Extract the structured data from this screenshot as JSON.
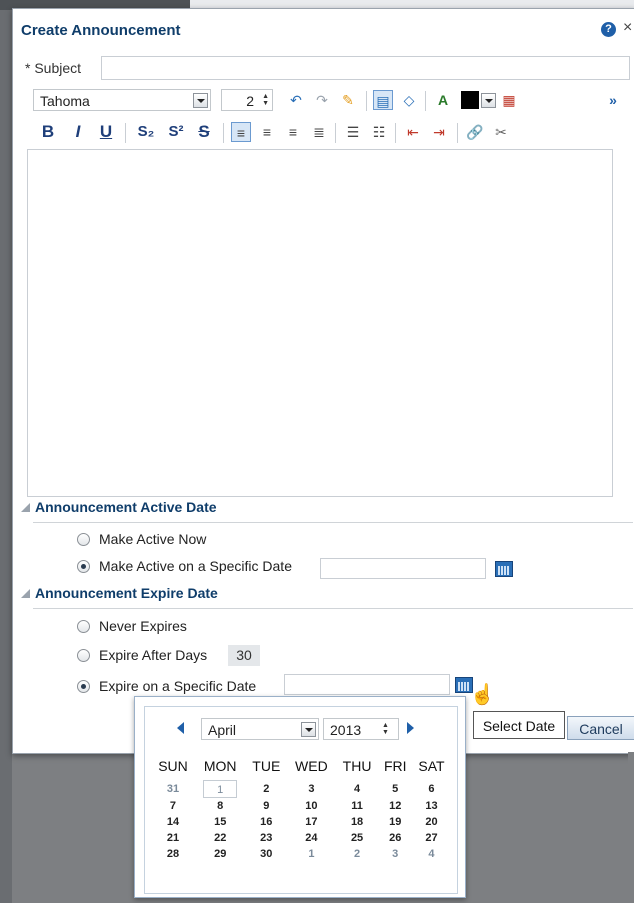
{
  "dialog": {
    "title": "Create Announcement",
    "help_icon": "?",
    "close_icon": "×"
  },
  "subject": {
    "label": "* Subject",
    "value": ""
  },
  "toolbar": {
    "font_family": "Tahoma",
    "font_size": "2",
    "overflow_glyph": "»",
    "icons_row1": [
      "undo-icon",
      "redo-icon",
      "clear-formatting-icon",
      "rich-text-mode-icon",
      "source-code-mode-icon",
      "font-color-icon",
      "color-swatch",
      "color-dropdown",
      "background-color-icon",
      "more-icon"
    ],
    "bold": "B",
    "italic": "I",
    "underline": "U",
    "subscript": "S₂",
    "superscript": "S²",
    "strikethrough": "S",
    "icons_row2": [
      "align-left-icon",
      "align-center-icon",
      "align-right-icon",
      "justify-icon",
      "bulleted-list-icon",
      "numbered-list-icon",
      "outdent-icon",
      "indent-icon",
      "link-icon",
      "unlink-icon"
    ],
    "swatch_color": "#000000"
  },
  "active_date": {
    "heading": "Announcement Active Date",
    "option_now": "Make Active Now",
    "option_specific": "Make Active on a Specific Date",
    "selected": "specific",
    "date_value": ""
  },
  "expire_date": {
    "heading": "Announcement Expire Date",
    "option_never": "Never Expires",
    "option_after_days": "Expire After Days",
    "days_value": "30",
    "option_specific": "Expire on a Specific Date",
    "selected": "specific",
    "date_value": ""
  },
  "tooltip": "Select Date",
  "cancel_label": "Cancel",
  "datepicker": {
    "month": "April",
    "year": "2013",
    "weekdays": [
      "SUN",
      "MON",
      "TUE",
      "WED",
      "THU",
      "FRI",
      "SAT"
    ],
    "weeks": [
      [
        "31",
        "1",
        "2",
        "3",
        "4",
        "5",
        "6"
      ],
      [
        "7",
        "8",
        "9",
        "10",
        "11",
        "12",
        "13"
      ],
      [
        "14",
        "15",
        "16",
        "17",
        "18",
        "19",
        "20"
      ],
      [
        "21",
        "22",
        "23",
        "24",
        "25",
        "26",
        "27"
      ],
      [
        "28",
        "29",
        "30",
        "1",
        "2",
        "3",
        "4"
      ]
    ]
  },
  "colors": {
    "accent": "#0f3d6a",
    "link_blue": "#1f5fa8",
    "overlay": "#7d7f82"
  }
}
